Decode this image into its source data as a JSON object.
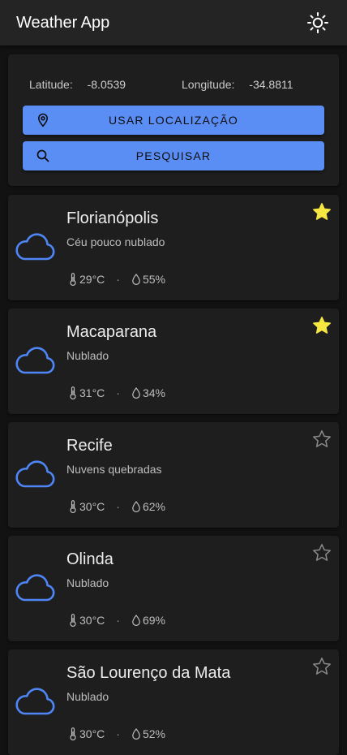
{
  "app": {
    "title": "Weather App"
  },
  "location": {
    "latitude_label": "Latitude:",
    "latitude_value": "-8.0539",
    "longitude_label": "Longitude:",
    "longitude_value": "-34.8811",
    "use_location_label": "USAR LOCALIZAÇÃO",
    "search_label": "PESQUISAR"
  },
  "colors": {
    "accent": "#5b8ef5",
    "star_active": "#f5e642",
    "star_inactive": "#8a8a8a",
    "cloud_icon": "#4f86f7"
  },
  "cities": [
    {
      "name": "Florianópolis",
      "description": "Céu pouco nublado",
      "temperature": "29°C",
      "humidity": "55%",
      "favorite": true,
      "icon": "cloud-icon"
    },
    {
      "name": "Macaparana",
      "description": "Nublado",
      "temperature": "31°C",
      "humidity": "34%",
      "favorite": true,
      "icon": "cloud-icon"
    },
    {
      "name": "Recife",
      "description": "Nuvens quebradas",
      "temperature": "30°C",
      "humidity": "62%",
      "favorite": false,
      "icon": "cloud-icon"
    },
    {
      "name": "Olinda",
      "description": "Nublado",
      "temperature": "30°C",
      "humidity": "69%",
      "favorite": false,
      "icon": "cloud-icon"
    },
    {
      "name": "São Lourenço da Mata",
      "description": "Nublado",
      "temperature": "30°C",
      "humidity": "52%",
      "favorite": false,
      "icon": "cloud-icon"
    }
  ]
}
